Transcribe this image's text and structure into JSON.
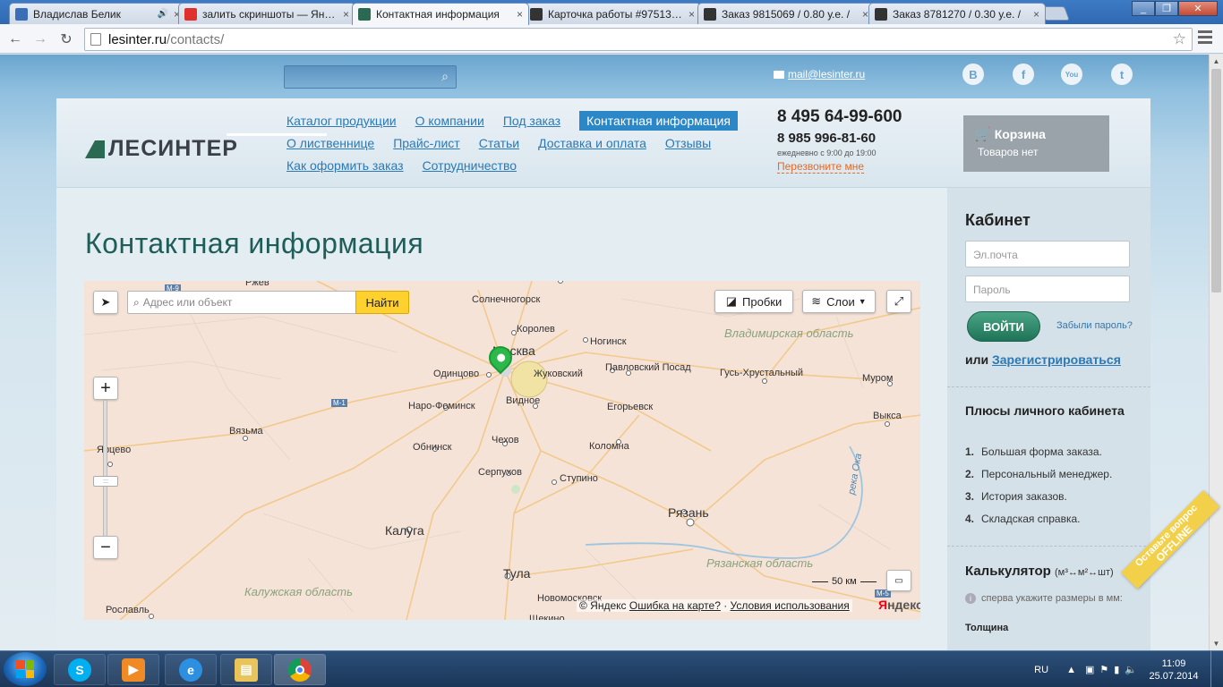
{
  "browser": {
    "tabs": [
      {
        "title": "Владислав Белик",
        "favicon": "play-icon",
        "color": "#3a6fb7",
        "audio": true
      },
      {
        "title": "залить скриншоты — Ян…",
        "favicon": "yandex-icon",
        "color": "#e0302b",
        "audio": false
      },
      {
        "title": "Контактная информация",
        "favicon": "lesinter-icon",
        "color": "#2a6a52",
        "audio": false
      },
      {
        "title": "Карточка работы #97513…",
        "favicon": "a-icon",
        "color": "#333333",
        "audio": false
      },
      {
        "title": "Заказ 9815069 / 0.80 у.е. /",
        "favicon": "a-icon",
        "color": "#333333",
        "audio": false
      },
      {
        "title": "Заказ 8781270 / 0.30 у.е. /",
        "favicon": "a-icon",
        "color": "#333333",
        "audio": false
      }
    ],
    "url_host": "lesinter.ru",
    "url_path": "/contacts/"
  },
  "site": {
    "email": "mail@lesinter.ru",
    "social": [
      "В",
      "f",
      "You",
      "t"
    ],
    "logo_text": "ЛЕСИНТЕР",
    "nav_rows": [
      [
        "Каталог продукции",
        "О компании",
        "Под заказ",
        "Контактная информация"
      ],
      [
        "О лиственнице",
        "Прайс-лист",
        "Статьи",
        "Доставка и оплата",
        "Отзывы"
      ],
      [
        "Как оформить заказ",
        "Сотрудничество"
      ]
    ],
    "active_nav": "Контактная информация",
    "phone1": "8 495 64-99-600",
    "phone2": "8 985 996-81-60",
    "hours": "ежедневно с 9:00 до 19:00",
    "callback": "Перезвоните мне",
    "cart": {
      "title": "Корзина",
      "subtitle": "Товаров нет"
    },
    "page_title": "Контактная информация"
  },
  "map": {
    "search_placeholder": "Адрес или объект",
    "find_label": "Найти",
    "traffic_label": "Пробки",
    "layers_label": "Слои",
    "zoom_in": "+",
    "zoom_out": "−",
    "scale": "50 км",
    "copyright": "© Яндекс",
    "error_link": "Ошибка на карте?",
    "terms_link": "Условия использования",
    "brand_a": "Я",
    "brand_b": "ндекс",
    "cities": [
      {
        "name": "Солнечногорск"
      },
      {
        "name": "Королев"
      },
      {
        "name": "Москва"
      },
      {
        "name": "Ногинск"
      },
      {
        "name": "Одинцово"
      },
      {
        "name": "Жуковский"
      },
      {
        "name": "Павловский Посад"
      },
      {
        "name": "Гусь-Хрустальный"
      },
      {
        "name": "Муром"
      },
      {
        "name": "Наро-Фоминск"
      },
      {
        "name": "Видное"
      },
      {
        "name": "Егорьевск"
      },
      {
        "name": "Выкса"
      },
      {
        "name": "Вязьма"
      },
      {
        "name": "Ярцево"
      },
      {
        "name": "Обнинск"
      },
      {
        "name": "Чехов"
      },
      {
        "name": "Коломна"
      },
      {
        "name": "Серпухов"
      },
      {
        "name": "Ступино"
      },
      {
        "name": "Рязань"
      },
      {
        "name": "Калуга"
      },
      {
        "name": "Тула"
      },
      {
        "name": "Новомосковск"
      },
      {
        "name": "Рославль"
      },
      {
        "name": "Щекино"
      },
      {
        "name": "Ржев"
      }
    ],
    "regions": [
      "Владимирская область",
      "Рязанская область",
      "Калужская область"
    ],
    "river": "река Ока",
    "road_signs": [
      "М-1",
      "М-5",
      "М-9"
    ]
  },
  "sidebar": {
    "cabinet_title": "Кабинет",
    "email_placeholder": "Эл.почта",
    "password_placeholder": "Пароль",
    "login_label": "ВОЙТИ",
    "forgot_label": "Забыли пароль?",
    "or_label": "или",
    "register_label": "Зарегистрироваться",
    "perks_title": "Плюсы личного кабинета",
    "perks": [
      "Большая форма заказа.",
      "Персональный менеджер.",
      "История заказов.",
      "Складская справка."
    ],
    "calc_title": "Калькулятор",
    "calc_units": "(м³↔м²↔шт)",
    "calc_hint": "сперва укажите размеры в мм:",
    "thickness_label": "Толщина",
    "ribbon_a": "Оставьте вопрос",
    "ribbon_b": "OFFLINE"
  },
  "taskbar": {
    "lang": "RU",
    "time": "11:09",
    "date": "25.07.2014",
    "apps": [
      "skype-icon",
      "media-player-icon",
      "ie-icon",
      "explorer-icon",
      "chrome-icon"
    ]
  }
}
